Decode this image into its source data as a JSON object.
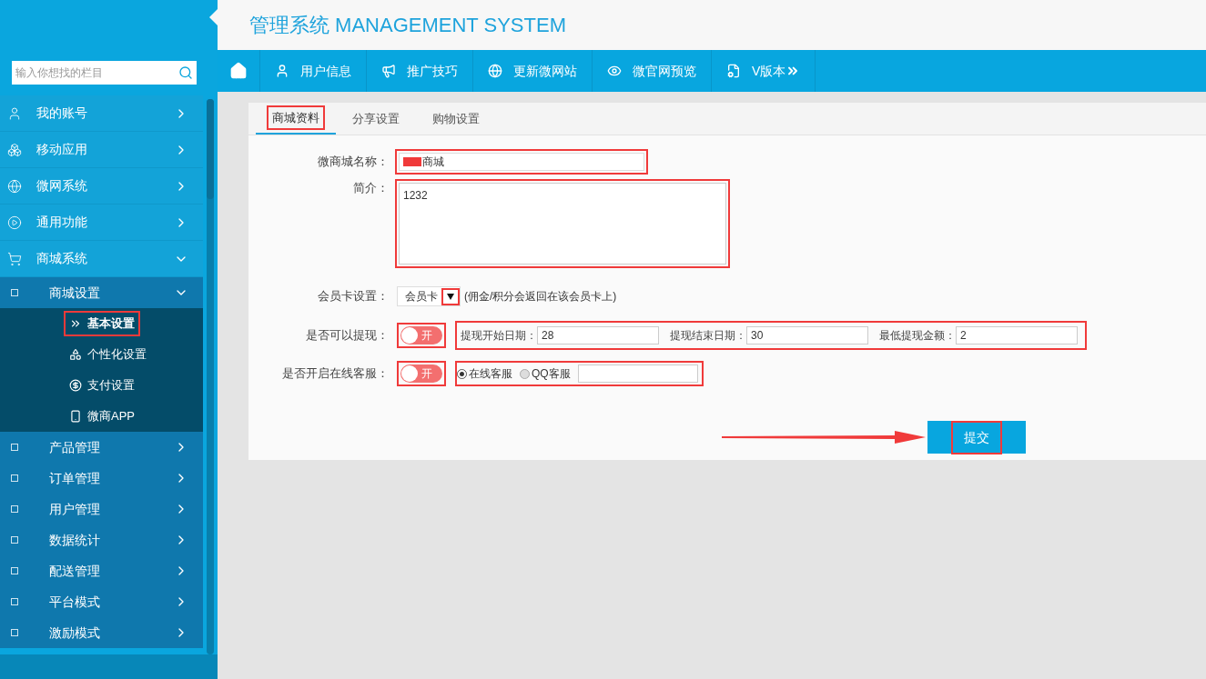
{
  "sidebar": {
    "search_placeholder": "输入你想找的栏目",
    "items": [
      {
        "label": "我的账号",
        "expanded": false
      },
      {
        "label": "移动应用",
        "expanded": false
      },
      {
        "label": "微网系统",
        "expanded": false
      },
      {
        "label": "通用功能",
        "expanded": false
      },
      {
        "label": "商城系统",
        "expanded": true,
        "children": [
          {
            "label": "商城设置",
            "expanded": true,
            "children": [
              {
                "label": "基本设置",
                "selected": true,
                "highlighted": true
              },
              {
                "label": "个性化设置",
                "selected": false
              },
              {
                "label": "支付设置",
                "selected": false
              },
              {
                "label": "微商APP",
                "selected": false
              }
            ]
          },
          {
            "label": "产品管理",
            "expanded": false
          },
          {
            "label": "订单管理",
            "expanded": false
          },
          {
            "label": "用户管理",
            "expanded": false
          },
          {
            "label": "数据统计",
            "expanded": false
          },
          {
            "label": "配送管理",
            "expanded": false
          },
          {
            "label": "平台模式",
            "expanded": false
          },
          {
            "label": "激励模式",
            "expanded": false
          }
        ]
      }
    ]
  },
  "header": {
    "title": "管理系统 MANAGEMENT SYSTEM"
  },
  "nav": [
    {
      "label": "用户信息"
    },
    {
      "label": "推广技巧"
    },
    {
      "label": "更新微网站"
    },
    {
      "label": "微官网预览"
    },
    {
      "label": "V版本"
    }
  ],
  "tabs": [
    {
      "label": "商城资料",
      "selected": true,
      "highlighted": true
    },
    {
      "label": "分享设置",
      "selected": false,
      "highlighted": false
    },
    {
      "label": "购物设置",
      "selected": false,
      "highlighted": false
    }
  ],
  "form": {
    "name": {
      "label": "微商城名称：",
      "value": "商城",
      "redacted": true,
      "highlighted": true
    },
    "intro": {
      "label": "简介：",
      "value": "1232",
      "highlighted": true
    },
    "member_card": {
      "label": "会员卡设置：",
      "value": "会员卡",
      "hint": "(佣金/积分会返回在该会员卡上)",
      "highlighted": true
    },
    "withdraw": {
      "label": "是否可以提现：",
      "toggle": {
        "on": true,
        "text": "开",
        "highlighted": true
      },
      "highlighted": true,
      "fields": [
        {
          "label": "提现开始日期：",
          "value": "28"
        },
        {
          "label": "提现结束日期：",
          "value": "30"
        },
        {
          "label": "最低提现金额：",
          "value": "2"
        }
      ]
    },
    "service": {
      "label": "是否开启在线客服：",
      "toggle": {
        "on": true,
        "text": "开",
        "highlighted": true
      },
      "highlighted": true,
      "radios": [
        {
          "label": "在线客服",
          "selected": true
        },
        {
          "label": "QQ客服",
          "selected": false
        }
      ]
    },
    "submit": {
      "label": "提交",
      "highlighted": true,
      "arrow": true
    }
  }
}
